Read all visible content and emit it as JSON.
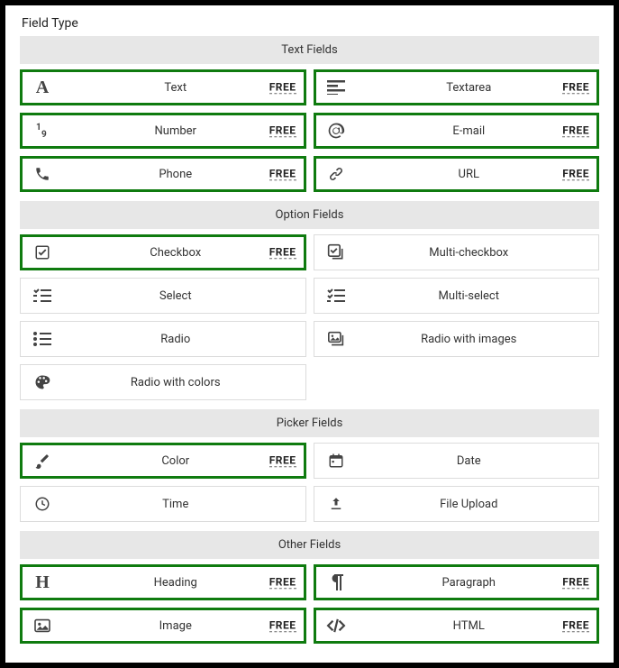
{
  "panel_title": "Field Type",
  "free_badge": "FREE",
  "sections": {
    "text": {
      "header": "Text Fields",
      "text": "Text",
      "textarea": "Textarea",
      "number": "Number",
      "email": "E-mail",
      "phone": "Phone",
      "url": "URL"
    },
    "option": {
      "header": "Option Fields",
      "checkbox": "Checkbox",
      "multicheckbox": "Multi-checkbox",
      "select": "Select",
      "multiselect": "Multi-select",
      "radio": "Radio",
      "radioimages": "Radio with images",
      "radiocolors": "Radio with colors"
    },
    "picker": {
      "header": "Picker Fields",
      "color": "Color",
      "date": "Date",
      "time": "Time",
      "fileupload": "File Upload"
    },
    "other": {
      "header": "Other Fields",
      "heading": "Heading",
      "paragraph": "Paragraph",
      "image": "Image",
      "html": "HTML"
    }
  }
}
